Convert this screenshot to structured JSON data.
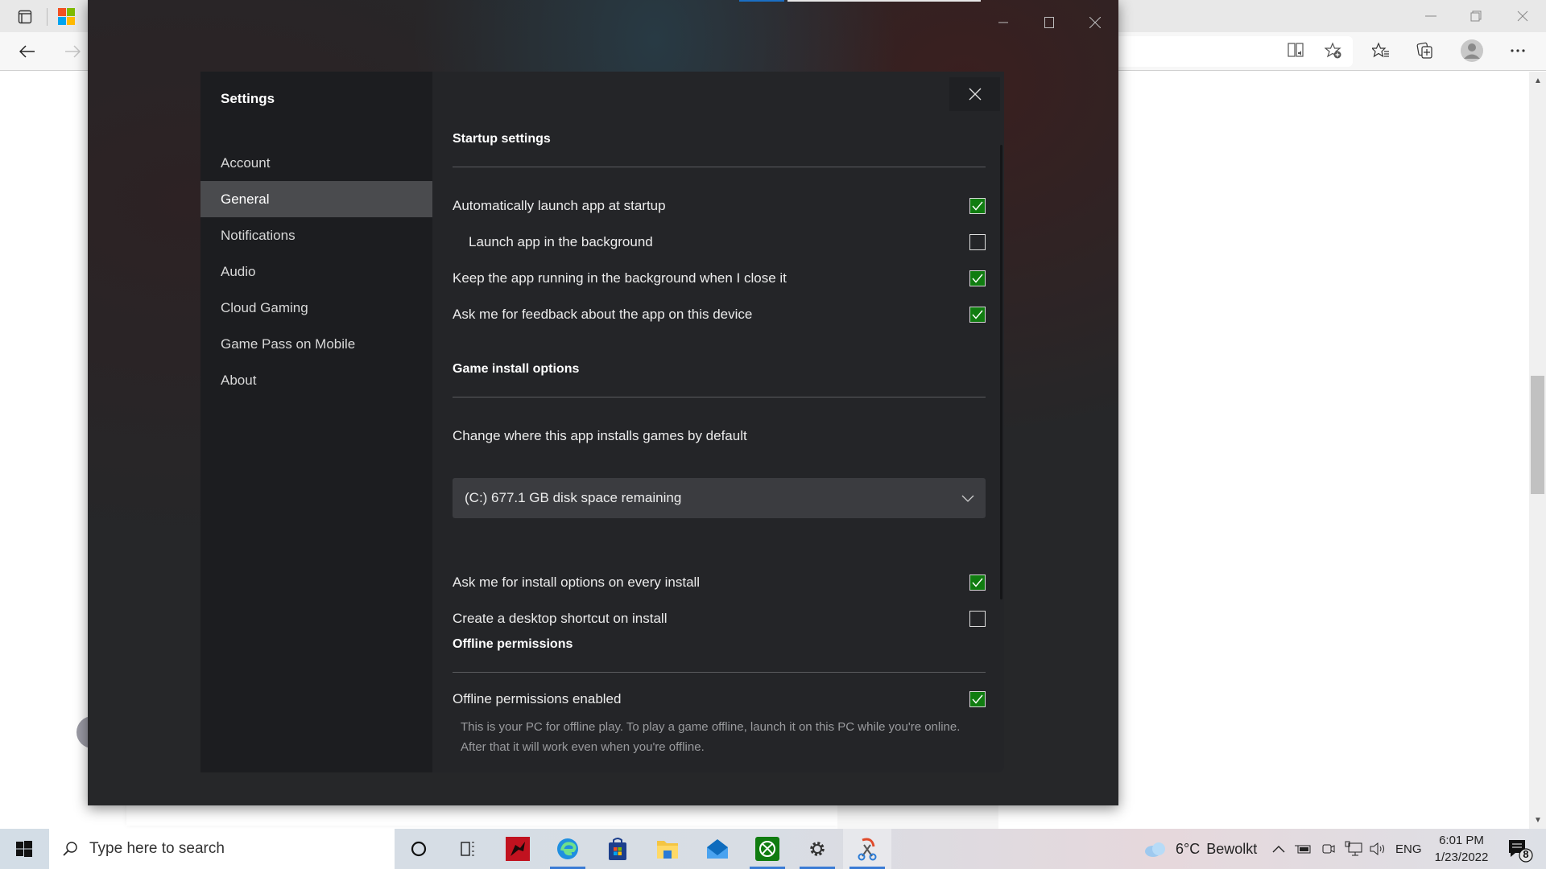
{
  "browser": {
    "title_bar_icons": [
      "tab-actions-icon",
      "microsoft-logo-icon"
    ],
    "toolbar_icons": [
      "back-icon",
      "forward-icon",
      "read-aloud-icon",
      "add-favorite-icon",
      "favorites-icon",
      "collections-icon",
      "profile-icon",
      "more-icon"
    ],
    "window_controls": [
      "minimize",
      "restore",
      "close"
    ]
  },
  "app": {
    "window_controls": [
      "minimize",
      "maximize",
      "close"
    ]
  },
  "settings": {
    "title": "Settings",
    "nav": [
      {
        "label": "Account",
        "active": false
      },
      {
        "label": "General",
        "active": true
      },
      {
        "label": "Notifications",
        "active": false
      },
      {
        "label": "Audio",
        "active": false
      },
      {
        "label": "Cloud Gaming",
        "active": false
      },
      {
        "label": "Game Pass on Mobile",
        "active": false
      },
      {
        "label": "About",
        "active": false
      }
    ],
    "sections": {
      "startup": {
        "title": "Startup settings",
        "options": [
          {
            "label": "Automatically launch app at startup",
            "checked": true
          },
          {
            "label": "Launch app in the background",
            "checked": false
          },
          {
            "label": "Keep the app running in the background when I close it",
            "checked": true
          },
          {
            "label": "Ask me for feedback about the app on this device",
            "checked": true
          }
        ]
      },
      "install": {
        "title": "Game install options",
        "location_label": "Change where this app installs games by default",
        "location_value": "(C:) 677.1 GB disk space remaining",
        "options": [
          {
            "label": "Ask me for install options on every install",
            "checked": true
          },
          {
            "label": "Create a desktop shortcut on install",
            "checked": false
          }
        ]
      },
      "offline": {
        "title": "Offline permissions",
        "options": [
          {
            "label": "Offline permissions enabled",
            "checked": true
          }
        ],
        "description": "This is your PC for offline play. To play a game offline, launch it on this PC while you're online. After that it will work even when you're offline."
      }
    },
    "accent_color": "#107c10"
  },
  "taskbar": {
    "search_placeholder": "Type here to search",
    "apps": [
      "cortana",
      "task-view",
      "dragon-app",
      "edge",
      "store",
      "file-explorer",
      "mail",
      "xbox",
      "settings",
      "snipping-tool"
    ],
    "weather": {
      "temp": "6°C",
      "condition": "Bewolkt"
    },
    "language": "ENG",
    "time": "6:01 PM",
    "date": "1/23/2022",
    "notification_count": "8"
  }
}
